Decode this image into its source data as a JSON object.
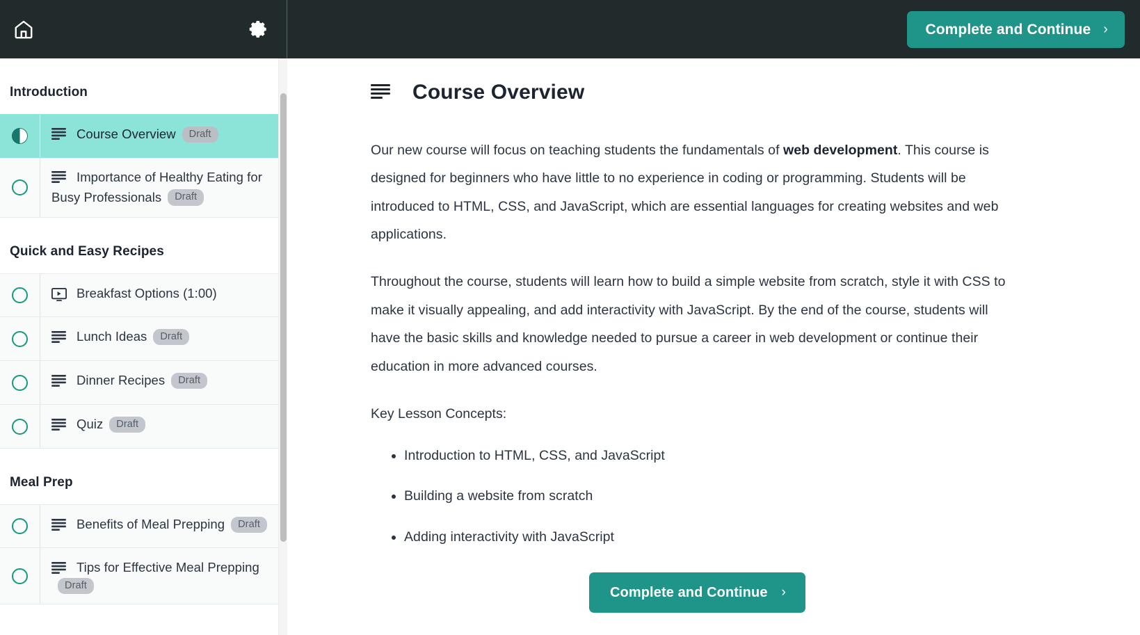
{
  "topbar": {
    "home_icon": "home-icon",
    "settings_icon": "gear-icon",
    "complete_button_label": "Complete and Continue",
    "chevron": "›"
  },
  "colors": {
    "header_bg": "#212b2b",
    "accent_teal": "#1f9488",
    "active_row_bg": "#8ce3d8",
    "circle_stroke": "#17987f",
    "badge_bg": "#c3c6cc",
    "text_dark": "#1c2331"
  },
  "sidebar": {
    "sections": [
      {
        "title": "Introduction",
        "lessons": [
          {
            "label": "Course Overview",
            "badge": "Draft",
            "icon": "text-lines-icon",
            "status": "half-circle-icon",
            "active": true
          },
          {
            "label": "Importance of Healthy Eating for Busy Professionals",
            "badge": "Draft",
            "icon": "text-lines-icon",
            "status": "circle-icon",
            "active": false
          }
        ]
      },
      {
        "title": "Quick and Easy Recipes",
        "lessons": [
          {
            "label": "Breakfast Options (1:00)",
            "badge": "",
            "icon": "video-icon",
            "status": "circle-icon",
            "active": false
          },
          {
            "label": "Lunch Ideas",
            "badge": "Draft",
            "icon": "text-lines-icon",
            "status": "circle-icon",
            "active": false
          },
          {
            "label": "Dinner Recipes",
            "badge": "Draft",
            "icon": "text-lines-icon",
            "status": "circle-icon",
            "active": false
          },
          {
            "label": "Quiz",
            "badge": "Draft",
            "icon": "text-lines-icon",
            "status": "circle-icon",
            "active": false
          }
        ]
      },
      {
        "title": "Meal Prep",
        "lessons": [
          {
            "label": "Benefits of Meal Prepping",
            "badge": "Draft",
            "icon": "text-lines-icon",
            "status": "circle-icon",
            "active": false
          },
          {
            "label": "Tips for Effective Meal Prepping",
            "badge": "Draft",
            "icon": "text-lines-icon",
            "status": "circle-icon",
            "active": false
          }
        ]
      }
    ]
  },
  "main": {
    "title": "Course Overview",
    "title_icon": "text-lines-icon",
    "paragraph1_part1": "Our new course will focus on teaching students the fundamentals of ",
    "paragraph1_bold": "web development",
    "paragraph1_part2": ". This course is designed for beginners who have little to no experience in coding or programming. Students will be introduced to HTML, CSS, and JavaScript, which are essential languages for creating websites and web applications.",
    "paragraph2": "Throughout the course, students will learn how to build a simple website from scratch, style it with CSS to make it visually appealing, and add interactivity with JavaScript. By the end of the course, students will have the basic skills and knowledge needed to pursue a career in web development or continue their education in more advanced courses.",
    "concepts_heading": "Key Lesson Concepts:",
    "concepts": [
      "Introduction to HTML, CSS, and JavaScript",
      "Building a website from scratch",
      "Adding interactivity with JavaScript"
    ],
    "complete_button_label": "Complete and Continue",
    "chevron": "›"
  }
}
